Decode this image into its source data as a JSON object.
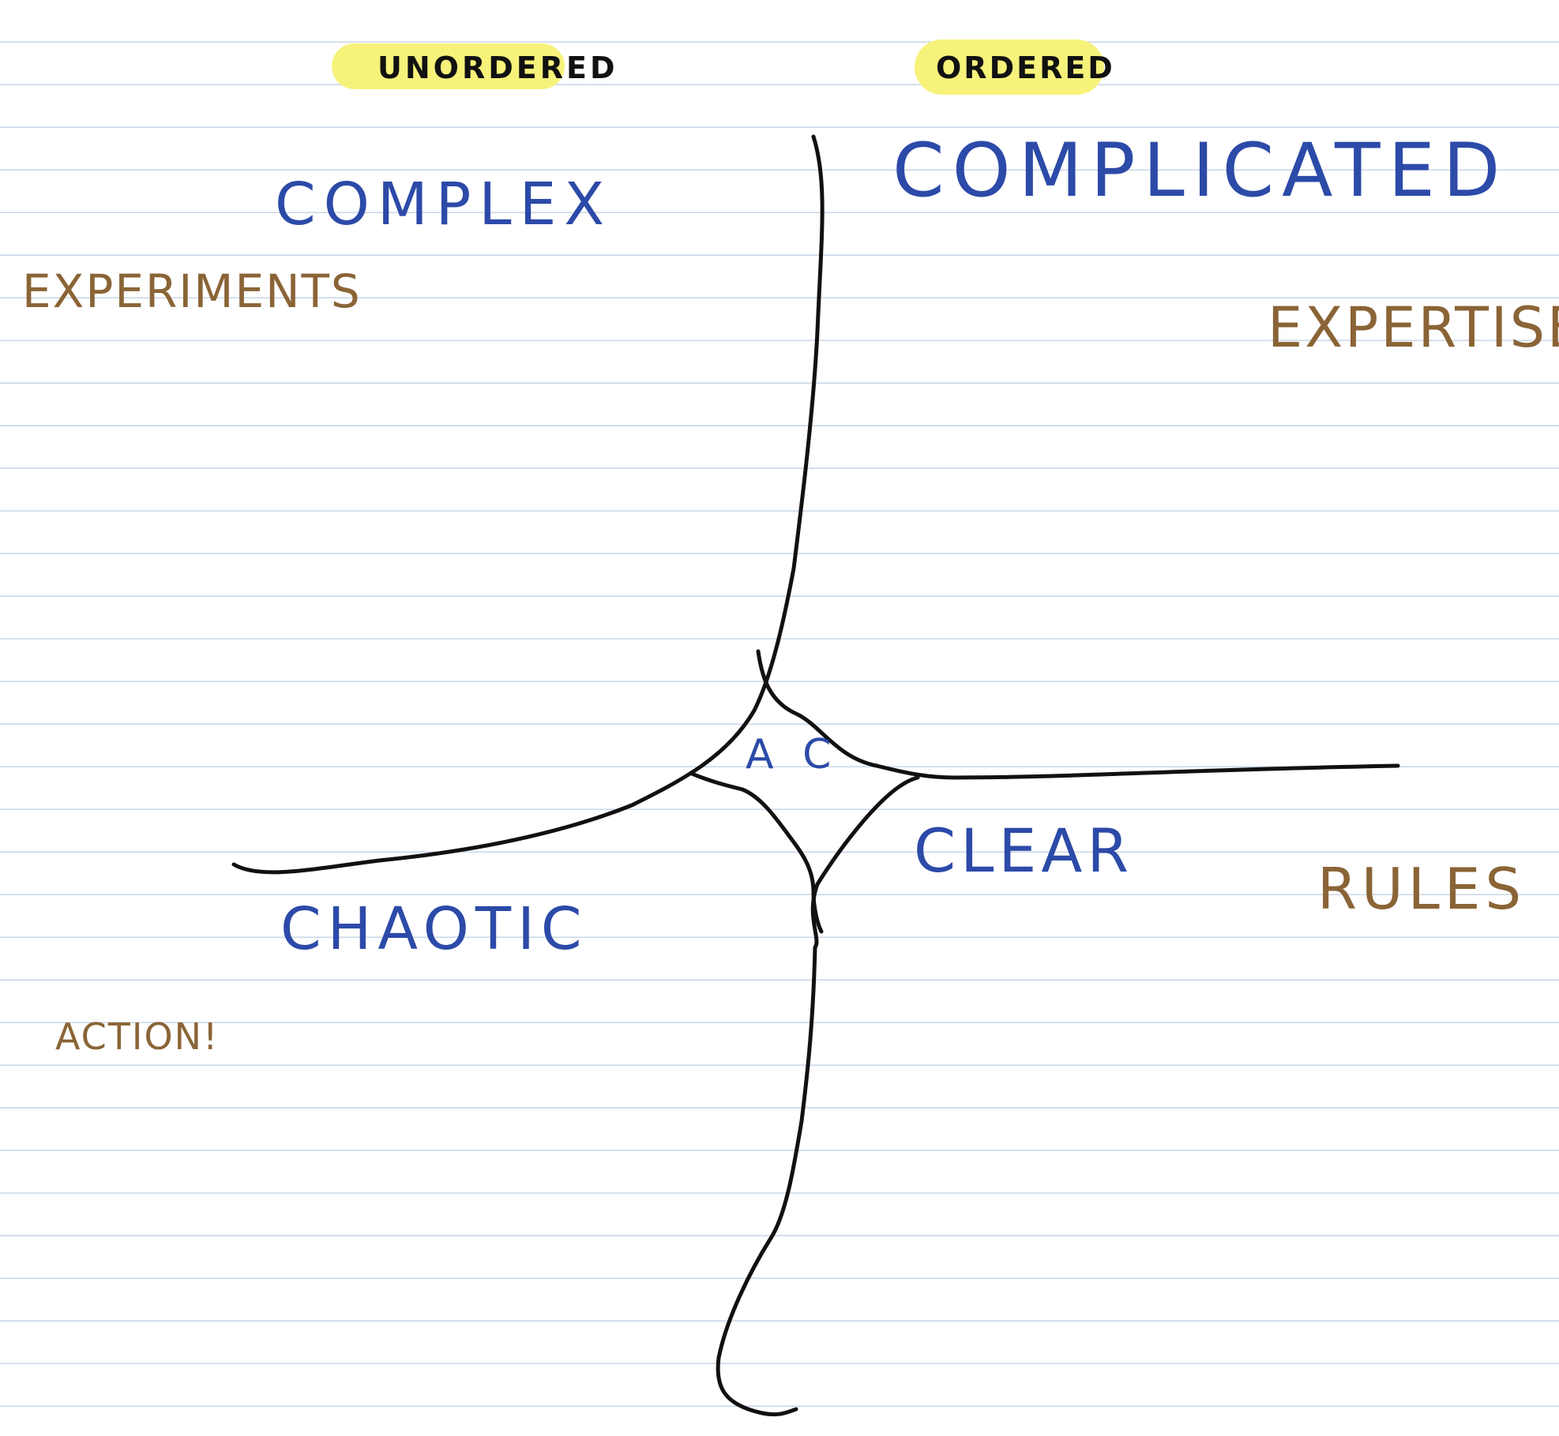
{
  "colors": {
    "paper": "#ffffff",
    "rule_line": "#c9d6e6",
    "ink_black": "#111111",
    "ink_blue": "#2c4aa8",
    "ink_brown": "#8a6436",
    "highlighter": "#f7f27a"
  },
  "headers": {
    "unordered": "UNORDERED",
    "ordered": "ORDERED"
  },
  "domains": {
    "complex": "COMPLEX",
    "complicated": "COMPLICATED",
    "chaotic": "CHAOTIC",
    "clear": "CLEAR",
    "center": "A C"
  },
  "approaches": {
    "complex": "EXPERIMENTS",
    "complicated": "EXPERTISE",
    "clear": "RULES",
    "chaotic": "ACTION!"
  }
}
